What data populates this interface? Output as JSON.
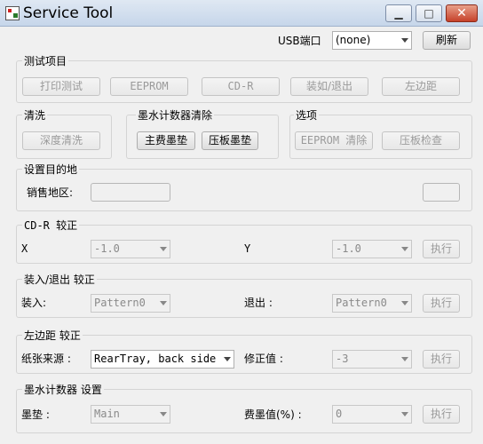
{
  "window": {
    "title": "Service Tool",
    "min": "▁",
    "max": "□",
    "close": "✕"
  },
  "usb": {
    "label": "USB端口",
    "value": "(none)",
    "refresh": "刷新"
  },
  "test": {
    "title": "测试项目",
    "print": "打印测试",
    "eeprom": "EEPROM",
    "cdr": "CD-R",
    "load": "装如/退出",
    "margin": "左边距"
  },
  "clean": {
    "title": "清洗",
    "deep": "深度清洗"
  },
  "ink_reset": {
    "title": "墨水计数器清除",
    "main": "主费墨垫",
    "platen": "压板墨垫"
  },
  "options": {
    "title": "选项",
    "eeprom_clear": "EEPROM 清除",
    "platen_check": "压板检查"
  },
  "dest": {
    "title": "设置目的地",
    "region_label": "销售地区:"
  },
  "cdr_adj": {
    "title": "CD-R 较正",
    "x_label": "X",
    "x_value": "-1.0",
    "y_label": "Y",
    "y_value": "-1.0",
    "exec": "执行"
  },
  "load_adj": {
    "title": "装入/退出 较正",
    "load_label": "装入:",
    "load_value": "Pattern0",
    "eject_label": "退出 :",
    "eject_value": "Pattern0",
    "exec": "执行"
  },
  "margin_adj": {
    "title": "左边距 较正",
    "source_label": "纸张来源 :",
    "source_value": "RearTray, back side",
    "correct_label": "修正值 :",
    "correct_value": "-3",
    "exec": "执行"
  },
  "counter": {
    "title": "墨水计数器 设置",
    "pad_label": "墨垫 :",
    "pad_value": "Main",
    "waste_label": "费墨值(%) :",
    "waste_value": "0",
    "exec": "执行"
  }
}
